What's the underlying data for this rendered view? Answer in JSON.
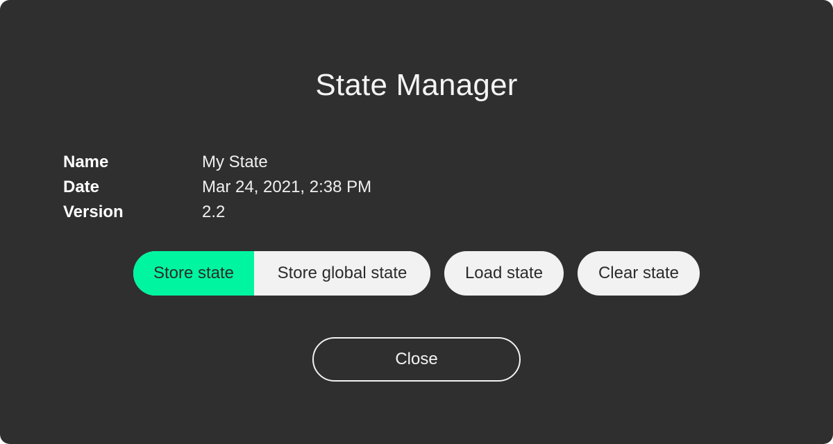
{
  "dialog": {
    "title": "State Manager",
    "info": [
      {
        "label": "Name",
        "value": "My State"
      },
      {
        "label": "Date",
        "value": "Mar 24, 2021, 2:38 PM"
      },
      {
        "label": "Version",
        "value": "2.2"
      }
    ],
    "buttons": {
      "store_state": "Store state",
      "store_global_state": "Store global state",
      "load_state": "Load state",
      "clear_state": "Clear state",
      "close": "Close"
    },
    "colors": {
      "background": "#2f2f2f",
      "accent": "#00f5a0",
      "button": "#f2f2f2"
    }
  }
}
